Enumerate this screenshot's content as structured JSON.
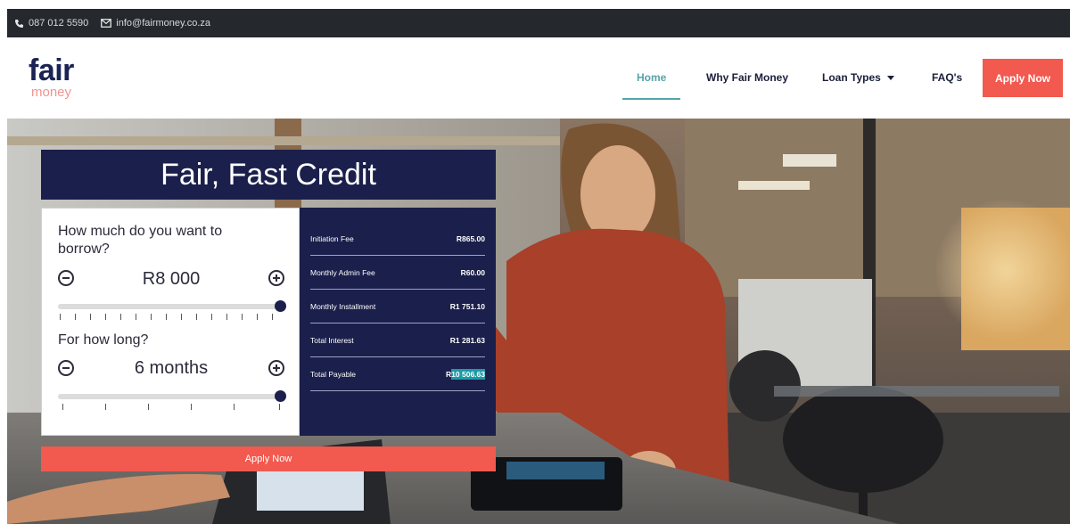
{
  "contact": {
    "phone": "087 012 5590",
    "email": "info@fairmoney.co.za"
  },
  "logo": {
    "word1": "fair",
    "word2": "money"
  },
  "nav": {
    "items": [
      {
        "label": "Home",
        "active": true
      },
      {
        "label": "Why Fair Money",
        "active": false
      },
      {
        "label": "Loan Types",
        "active": false,
        "dropdown": true
      },
      {
        "label": "FAQ's",
        "active": false
      }
    ],
    "cta": "Apply Now"
  },
  "calculator": {
    "title": "Fair, Fast Credit",
    "amount_question": "How much do you want to borrow?",
    "amount_value": "R8 000",
    "duration_question": "For how long?",
    "duration_value": "6 months",
    "breakdown": [
      {
        "label": "Initiation Fee",
        "value": "R865.00"
      },
      {
        "label": "Monthly Admin Fee",
        "value": "R60.00"
      },
      {
        "label": "Monthly Installment",
        "value": "R1 751.10"
      },
      {
        "label": "Total Interest",
        "value": "R1 281.63"
      },
      {
        "label": "Total Payable",
        "value": "R10 506.63",
        "value_prefix": "R",
        "value_highlight": "10 506.63"
      }
    ],
    "apply_label": "Apply Now"
  },
  "colors": {
    "navy": "#1b1f4b",
    "coral": "#f2594f",
    "teal": "#55a3a8",
    "topbar": "#25282d"
  }
}
